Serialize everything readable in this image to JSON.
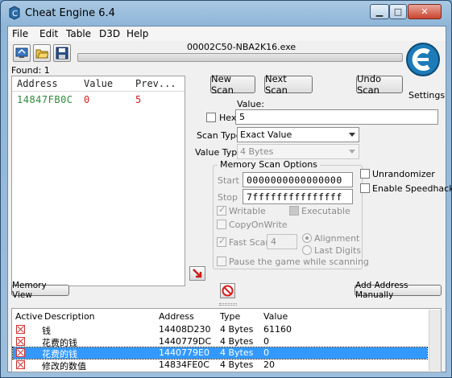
{
  "window": {
    "title": "Cheat Engine 6.4",
    "controls": [
      "minimize",
      "maximize",
      "close"
    ]
  },
  "menu": [
    "File",
    "Edit",
    "Table",
    "D3D",
    "Help"
  ],
  "toolbar": {
    "icons": [
      "open-process-icon",
      "open-file-icon",
      "save-icon"
    ]
  },
  "process_name": "00002C50-NBA2K16.exe",
  "found": "Found: 1",
  "results": {
    "headers": [
      "Address",
      "Value",
      "Prev..."
    ],
    "rows": [
      {
        "address": "14847FB0C",
        "value": "0",
        "previous": "5"
      }
    ],
    "address_color": "#2e8b3c",
    "value_color": "#d02020"
  },
  "scan": {
    "new_scan": "New Scan",
    "next_scan": "Next Scan",
    "undo_scan": "Undo Scan",
    "settings": "Settings",
    "value_label": "Value:",
    "hex_label": "Hex",
    "value": "5",
    "scan_type_label": "Scan Type",
    "scan_type": "Exact Value",
    "value_type_label": "Value Type",
    "value_type": "4 Bytes"
  },
  "memory_options": {
    "title": "Memory Scan Options",
    "start_label": "Start",
    "start": "0000000000000000",
    "stop_label": "Stop",
    "stop": "7fffffffffffffff",
    "writable": "Writable",
    "executable": "Executable",
    "copy_on_write": "CopyOnWrite",
    "fast_scan": "Fast Scan",
    "fast_scan_value": "4",
    "alignment": "Alignment",
    "last_digits": "Last Digits",
    "pause": "Pause the game while scanning"
  },
  "extra_options": {
    "unrandomizer": "Unrandomizer",
    "speedhack": "Enable Speedhack"
  },
  "bottom": {
    "memory_view": "Memory View",
    "add_address": "Add Address Manually"
  },
  "address_list": {
    "headers": [
      "Active",
      "Description",
      "Address",
      "Type",
      "Value"
    ],
    "rows": [
      {
        "description": "钱",
        "address": "14408D230",
        "type": "4 Bytes",
        "value": "61160",
        "selected": false
      },
      {
        "description": "花费的钱",
        "address": "1440779DC",
        "type": "4 Bytes",
        "value": "0",
        "selected": false
      },
      {
        "description": "花费的钱",
        "address": "1440779E0",
        "type": "4 Bytes",
        "value": "0",
        "selected": true
      },
      {
        "description": "修改的数值",
        "address": "14834FE0C",
        "type": "4 Bytes",
        "value": "20",
        "selected": false
      }
    ]
  }
}
